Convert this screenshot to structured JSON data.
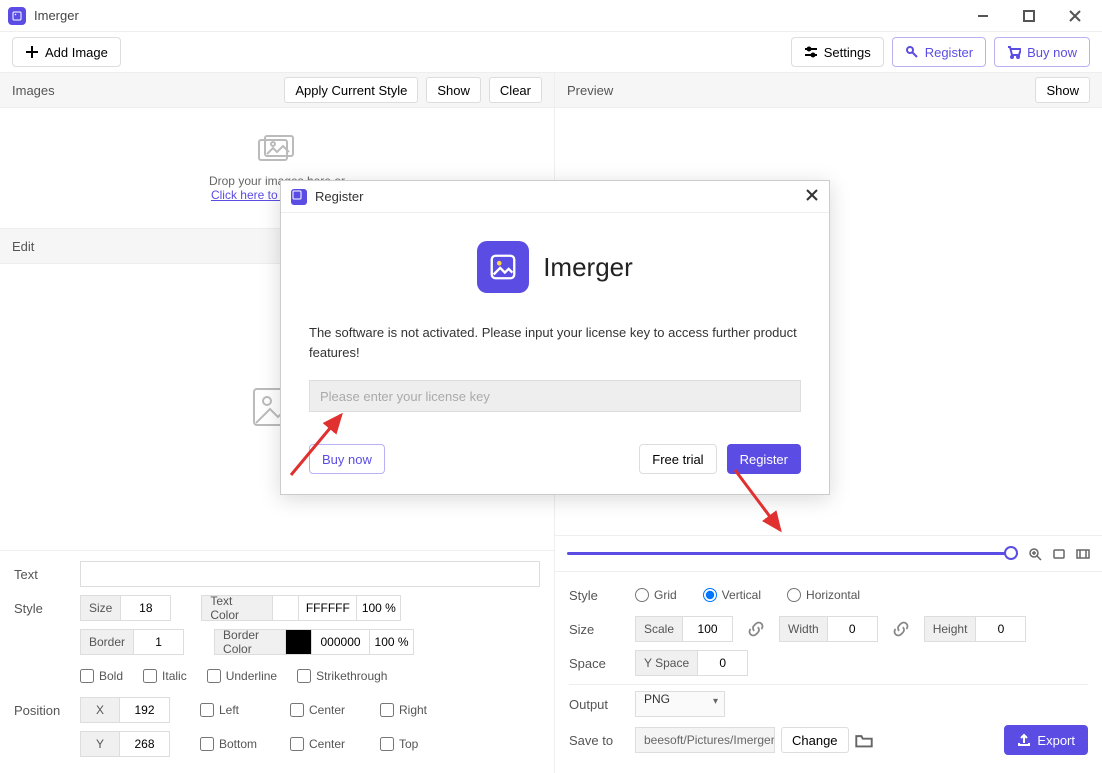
{
  "app": {
    "title": "Imerger"
  },
  "topbar": {
    "add_image": "Add Image",
    "settings": "Settings",
    "register": "Register",
    "buy_now": "Buy now"
  },
  "images_panel": {
    "title": "Images",
    "apply_style": "Apply Current Style",
    "show": "Show",
    "clear": "Clear",
    "drop_line": "Drop your images here or",
    "click_line": "Click here to add images"
  },
  "edit_panel": {
    "title": "Edit"
  },
  "text_panel": {
    "text_label": "Text",
    "style_label": "Style",
    "position_label": "Position",
    "size_label": "Size",
    "size_value": "18",
    "text_color_label": "Text Color",
    "text_color_value": "FFFFFF",
    "text_color_opacity": "100 %",
    "border_label": "Border",
    "border_value": "1",
    "border_color_label": "Border Color",
    "border_color_value": "000000",
    "border_color_opacity": "100 %",
    "bold": "Bold",
    "italic": "Italic",
    "underline": "Underline",
    "strike": "Strikethrough",
    "x_label": "X",
    "x_value": "192",
    "y_label": "Y",
    "y_value": "268",
    "left": "Left",
    "center": "Center",
    "right": "Right",
    "bottom": "Bottom",
    "top": "Top"
  },
  "preview_panel": {
    "title": "Preview",
    "show": "Show"
  },
  "layout_panel": {
    "style_label": "Style",
    "grid": "Grid",
    "vertical": "Vertical",
    "horizontal": "Horizontal",
    "size_label": "Size",
    "scale_label": "Scale",
    "scale_value": "100",
    "width_label": "Width",
    "width_value": "0",
    "height_label": "Height",
    "height_value": "0",
    "space_label": "Space",
    "yspace_label": "Y Space",
    "yspace_value": "0",
    "output_label": "Output",
    "output_value": "PNG",
    "save_label": "Save to",
    "save_path": "beesoft/Pictures/Imerger",
    "change": "Change",
    "export": "Export"
  },
  "modal": {
    "title": "Register",
    "brand": "Imerger",
    "message": "The software is not activated. Please input your license key to access further product features!",
    "placeholder": "Please enter your license key",
    "buy_now": "Buy now",
    "free_trial": "Free trial",
    "register": "Register"
  }
}
